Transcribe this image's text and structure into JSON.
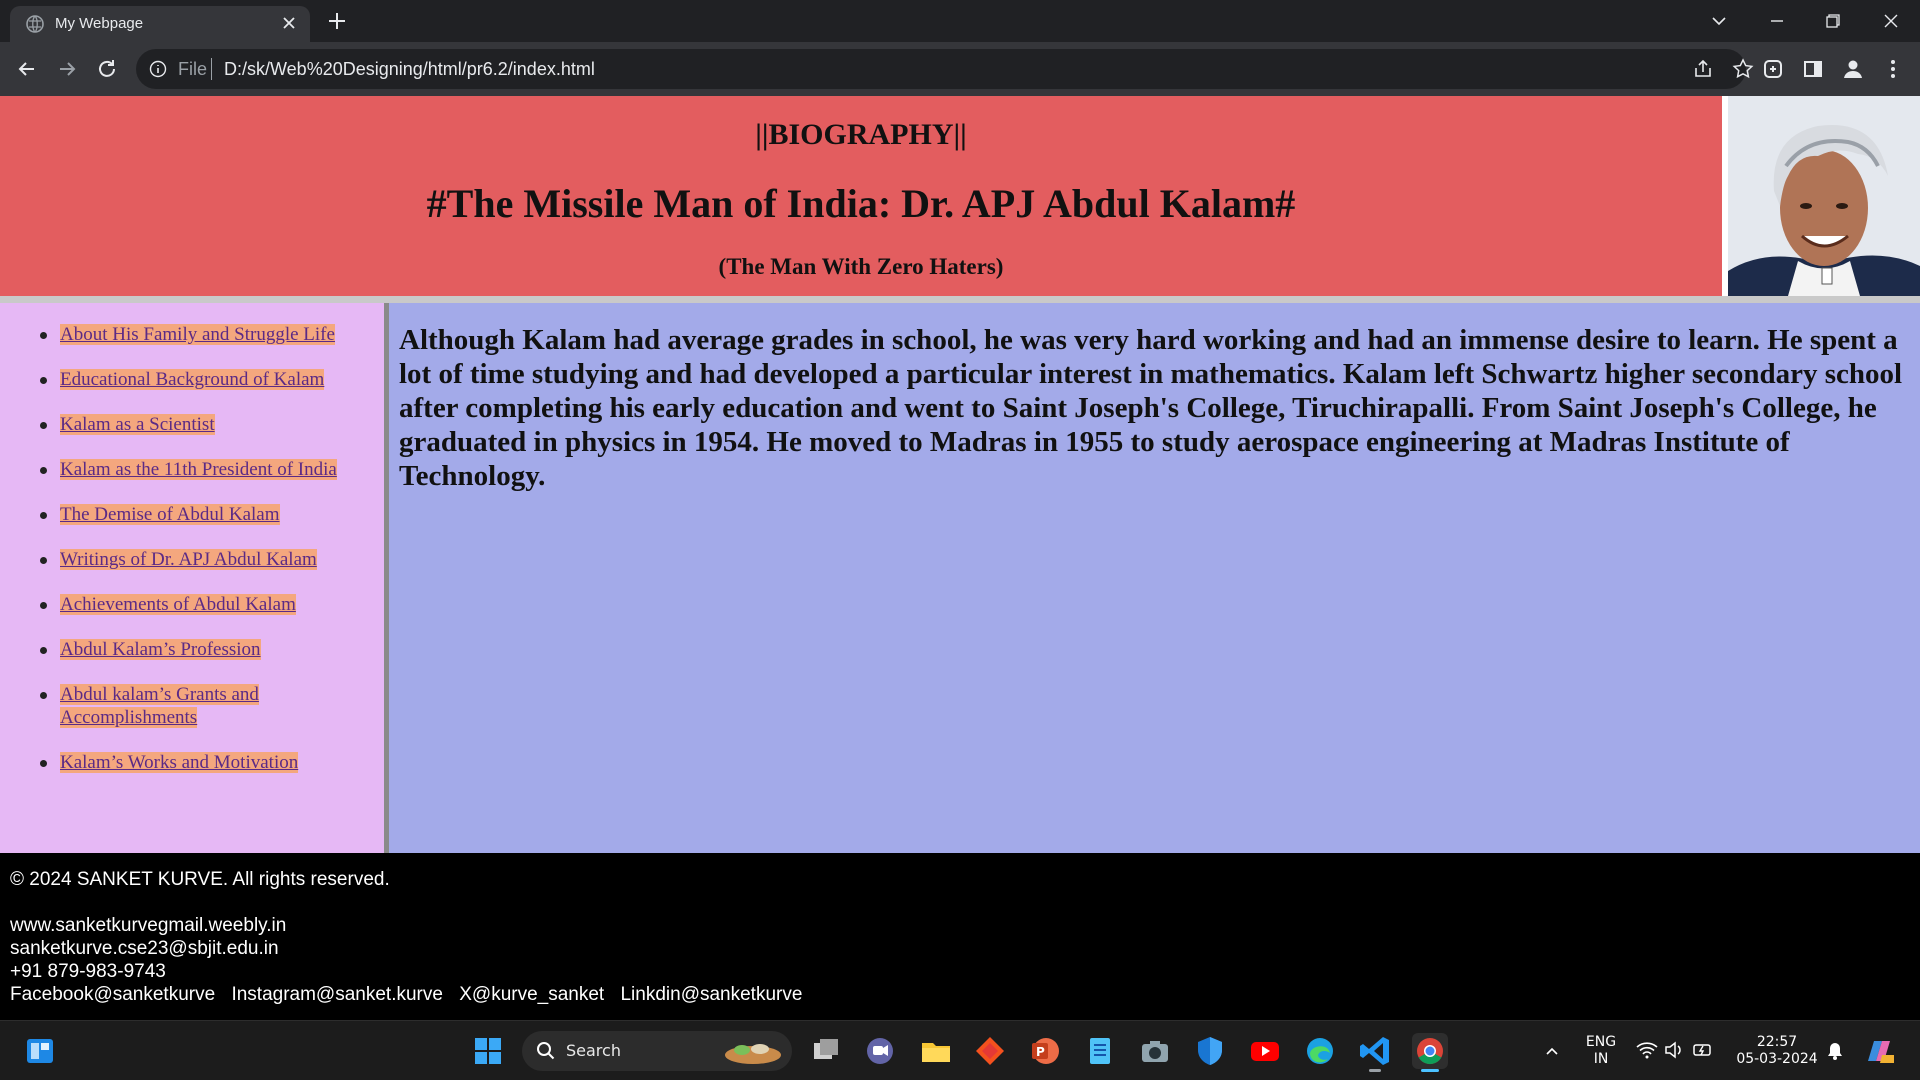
{
  "browser": {
    "tab_title": "My Webpage",
    "address_scheme": "File",
    "address_url": "D:/sk/Web%20Designing/html/pr6.2/index.html"
  },
  "header": {
    "biography": "||BIOGRAPHY||",
    "title": "#The Missile Man of India: Dr. APJ Abdul Kalam#",
    "subtitle": "(The Man With Zero Haters)"
  },
  "sidebar": {
    "links": [
      {
        "label": "About His Family and Struggle Life"
      },
      {
        "label": "Educational Background of Kalam"
      },
      {
        "label": "Kalam as a Scientist"
      },
      {
        "label": "Kalam as the 11th President of India"
      },
      {
        "label": "The Demise of Abdul Kalam"
      },
      {
        "label": "Writings of Dr. APJ Abdul Kalam"
      },
      {
        "label": "Achievements of Abdul Kalam"
      },
      {
        "label": "Abdul Kalam’s Profession"
      },
      {
        "label": "Abdul kalam’s Grants and Accomplishments"
      },
      {
        "label": "Kalam’s Works and Motivation"
      }
    ]
  },
  "content": {
    "paragraph": "Although Kalam had average grades in school, he was very hard working and had an immense desire to learn. He spent a lot of time studying and had developed a particular interest in mathematics. Kalam left Schwartz higher secondary school after completing his early education and went to Saint Joseph's College, Tiruchirapalli. From Saint Joseph's College, he graduated in physics in 1954. He moved to Madras in 1955 to study aerospace engineering at Madras Institute of Technology."
  },
  "footer": {
    "copyright": "© 2024 SANKET KURVE. All rights reserved.",
    "website": "www.sanketkurvegmail.weebly.in",
    "email": "sanketkurve.cse23@sbjit.edu.in",
    "phone": "+91 879-983-9743",
    "socials": [
      "Facebook@sanketkurve",
      "Instagram@sanket.kurve",
      "X@kurve_sanket",
      "Linkdin@sanketkurve"
    ]
  },
  "taskbar": {
    "search_label": "Search",
    "language_line1": "ENG",
    "language_line2": "IN",
    "time": "22:57",
    "date": "05-03-2024"
  },
  "colors": {
    "header_bg": "#e35d5f",
    "sidebar_bg": "#e6b8f5",
    "content_bg": "#a3aae9",
    "link_highlight": "#f4a77e",
    "footer_bg": "#000000"
  }
}
